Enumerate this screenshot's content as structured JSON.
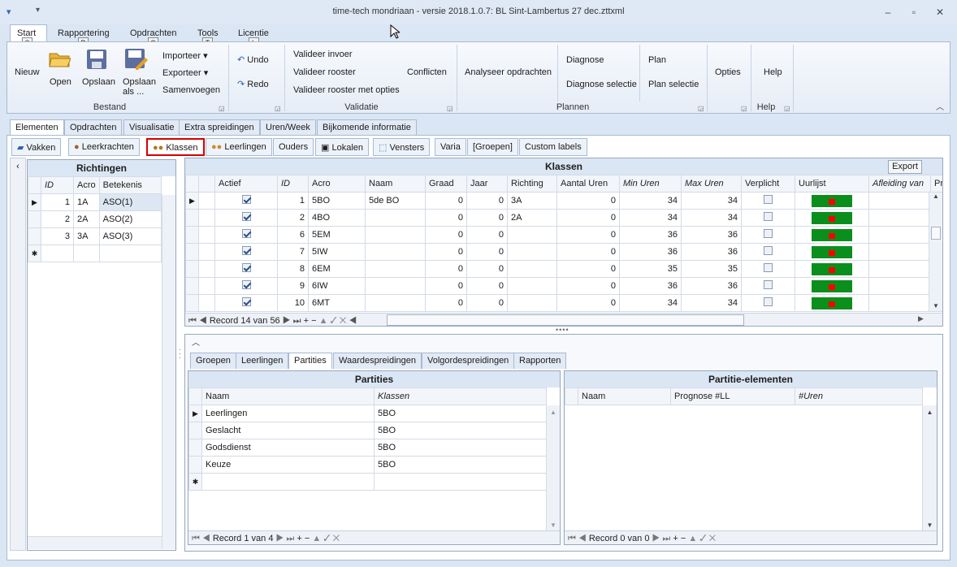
{
  "window": {
    "title": "time-tech mondriaan - versie 2018.1.0.7: BL Sint-Lambertus 27 dec.zttxml"
  },
  "ribbon_tabs": [
    {
      "label": "Start",
      "key": "S"
    },
    {
      "label": "Rapportering",
      "key": "R"
    },
    {
      "label": "Opdrachten",
      "key": "O"
    },
    {
      "label": "Tools",
      "key": "T"
    },
    {
      "label": "Licentie",
      "key": "L"
    }
  ],
  "ribbon": {
    "nieuw": "Nieuw",
    "open": "Open",
    "opslaan": "Opslaan",
    "opslaan_als": "Opslaan als ...",
    "importeer": "Importeer",
    "exporteer": "Exporteer",
    "samenvoegen": "Samenvoegen",
    "bestand": "Bestand",
    "undo": "Undo",
    "redo": "Redo",
    "valideer_invoer": "Valideer invoer",
    "valideer_rooster": "Valideer rooster",
    "valideer_opties": "Valideer rooster met opties",
    "conflicten": "Conflicten",
    "validatie": "Validatie",
    "analyseer": "Analyseer opdrachten",
    "diagnose": "Diagnose",
    "diagnose_selectie": "Diagnose selectie",
    "plan": "Plan",
    "plan_selectie": "Plan selectie",
    "plannen": "Plannen",
    "opties": "Opties",
    "help": "Help",
    "help_group": "Help"
  },
  "main_tabs": [
    "Elementen",
    "Opdrachten",
    "Visualisatie",
    "Extra spreidingen",
    "Uren/Week",
    "Bijkomende informatie"
  ],
  "sub_tabs": [
    "Vakken",
    "Leerkrachten",
    "Klassen",
    "Leerlingen",
    "Ouders",
    "Lokalen",
    "Vensters",
    "Varia",
    "[Groepen]",
    "Custom labels"
  ],
  "richtingen": {
    "title": "Richtingen",
    "columns": [
      "ID",
      "Acro",
      "Betekenis"
    ],
    "rows": [
      [
        "1",
        "1A",
        "ASO(1)"
      ],
      [
        "2",
        "2A",
        "ASO(2)"
      ],
      [
        "3",
        "3A",
        "ASO(3)"
      ]
    ]
  },
  "klassen": {
    "title": "Klassen",
    "export": "Export",
    "columns": [
      "Actief",
      "ID",
      "Acro",
      "Naam",
      "Graad",
      "Jaar",
      "Richting",
      "Aantal Uren",
      "Min Uren",
      "Max Uren",
      "Verplicht",
      "Uurlijst",
      "Afleiding van",
      "Pr"
    ],
    "rows": [
      {
        "id": "1",
        "acro": "5BO",
        "naam": "5de BO",
        "graad": "0",
        "jaar": "0",
        "richting": "3A",
        "aantal": "0",
        "min": "34",
        "max": "34"
      },
      {
        "id": "2",
        "acro": "4BO",
        "naam": "",
        "graad": "0",
        "jaar": "0",
        "richting": "2A",
        "aantal": "0",
        "min": "34",
        "max": "34"
      },
      {
        "id": "6",
        "acro": "5EM",
        "naam": "",
        "graad": "0",
        "jaar": "0",
        "richting": "",
        "aantal": "0",
        "min": "36",
        "max": "36"
      },
      {
        "id": "7",
        "acro": "5IW",
        "naam": "",
        "graad": "0",
        "jaar": "0",
        "richting": "",
        "aantal": "0",
        "min": "36",
        "max": "36"
      },
      {
        "id": "8",
        "acro": "6EM",
        "naam": "",
        "graad": "0",
        "jaar": "0",
        "richting": "",
        "aantal": "0",
        "min": "35",
        "max": "35"
      },
      {
        "id": "9",
        "acro": "6IW",
        "naam": "",
        "graad": "0",
        "jaar": "0",
        "richting": "",
        "aantal": "0",
        "min": "36",
        "max": "36"
      },
      {
        "id": "10",
        "acro": "6MT",
        "naam": "",
        "graad": "0",
        "jaar": "0",
        "richting": "",
        "aantal": "0",
        "min": "34",
        "max": "34"
      }
    ],
    "record": "Record 14 van 56"
  },
  "bottom_tabs": [
    "Groepen",
    "Leerlingen",
    "Partities",
    "Waardespreidingen",
    "Volgordespreidingen",
    "Rapporten"
  ],
  "partities": {
    "title": "Partities",
    "columns": [
      "Naam",
      "Klassen"
    ],
    "rows": [
      [
        "Leerlingen",
        "5BO"
      ],
      [
        "Geslacht",
        "5BO"
      ],
      [
        "Godsdienst",
        "5BO"
      ],
      [
        "Keuze",
        "5BO"
      ]
    ],
    "record": "Record 1 van 4"
  },
  "elementen": {
    "title": "Partitie-elementen",
    "columns": [
      "Naam",
      "Prognose #LL",
      "#Uren"
    ],
    "record": "Record 0 van 0"
  },
  "colors": {
    "accent": "#0b8f1c",
    "highlight": "#d40000"
  }
}
